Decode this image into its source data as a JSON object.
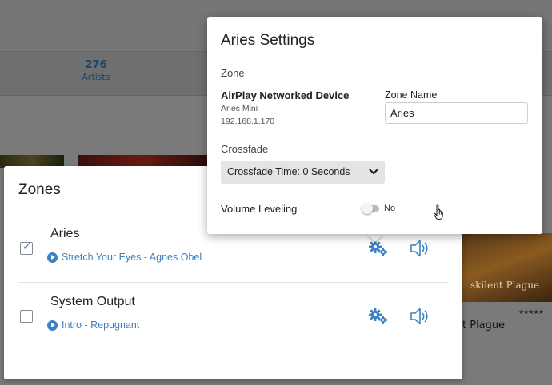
{
  "background": {
    "stat": {
      "value": "276",
      "label": "Artists"
    },
    "album_title_partial": "t Plague",
    "album_art_text": "skilent Plague",
    "album_rating": "★★★★★"
  },
  "zones_dialog": {
    "title": "Zones",
    "zones": [
      {
        "name": "Aries",
        "checked": true,
        "now_playing": "Stretch Your Eyes - Agnes Obel"
      },
      {
        "name": "System Output",
        "checked": false,
        "now_playing": "Intro - Repugnant"
      }
    ]
  },
  "settings": {
    "title": "Aries Settings",
    "zone_section_label": "Zone",
    "device_type": "AirPlay Networked Device",
    "device_model": "Aries Mini",
    "device_ip": "192.168.1.170",
    "zone_name_label": "Zone Name",
    "zone_name_value": "Aries",
    "crossfade_label": "Crossfade",
    "crossfade_value": "Crossfade Time: 0 Seconds",
    "volume_leveling_label": "Volume Leveling",
    "volume_leveling_value": "No",
    "volume_leveling_enabled": false
  },
  "colors": {
    "accent": "#3b82c4",
    "dim_overlay": "#7a7a7a"
  }
}
